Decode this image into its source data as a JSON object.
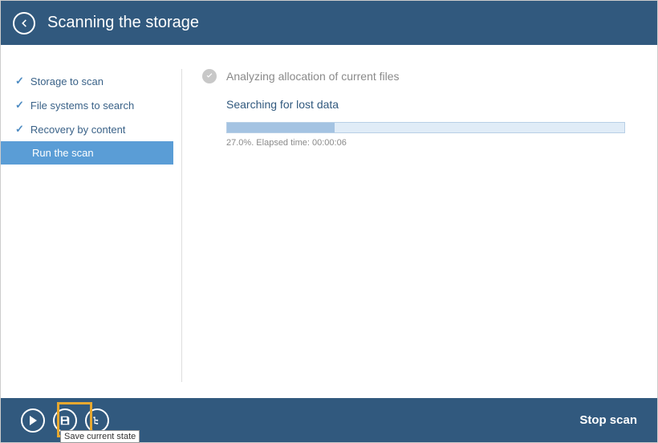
{
  "header": {
    "title": "Scanning the storage"
  },
  "sidebar": {
    "items": [
      {
        "label": "Storage to scan",
        "done": true
      },
      {
        "label": "File systems to search",
        "done": true
      },
      {
        "label": "Recovery by content",
        "done": true
      },
      {
        "label": "Run the scan",
        "done": false
      }
    ]
  },
  "content": {
    "completed_step": "Analyzing allocation of current files",
    "current_step": "Searching for lost data",
    "progress_percent": 27.0,
    "progress_text": "27.0%. Elapsed time: 00:00:06"
  },
  "footer": {
    "tooltip": "Save current state",
    "stop_label": "Stop scan"
  }
}
